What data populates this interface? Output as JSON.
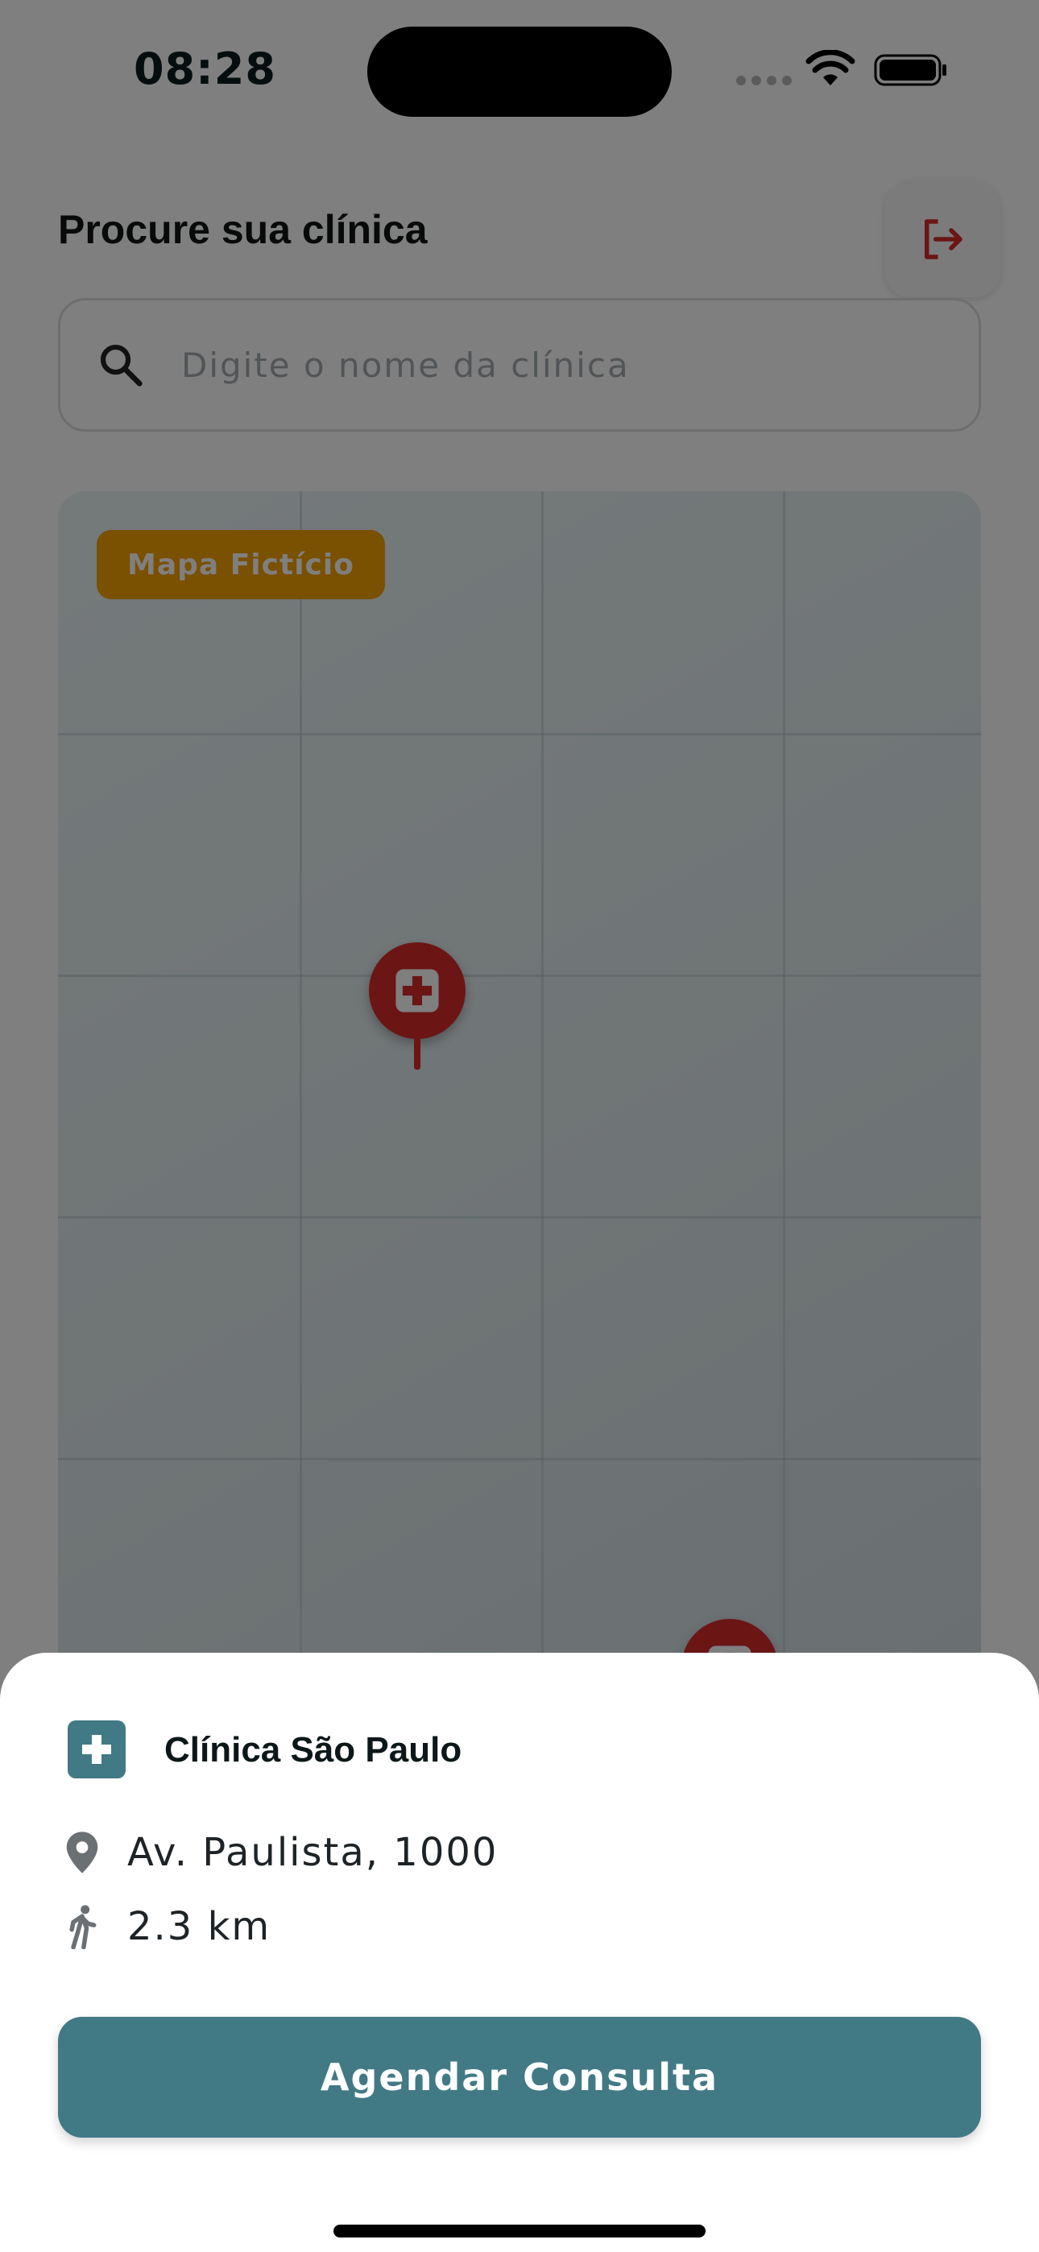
{
  "status_bar": {
    "time": "08:28"
  },
  "header": {
    "title": "Procure sua clínica",
    "logout_icon": "logout-icon"
  },
  "search": {
    "placeholder": "Digite o nome da clínica",
    "value": "",
    "icon": "search-icon"
  },
  "map": {
    "tag_label": "Mapa Fictício",
    "pin_icon": "medical-cross-icon",
    "pin_color": "#d62b2b"
  },
  "clinic_sheet": {
    "name": "Clínica São Paulo",
    "address": "Av. Paulista, 1000",
    "distance": "2.3 km",
    "action_label": "Agendar Consulta",
    "accent_color": "#417a85"
  }
}
